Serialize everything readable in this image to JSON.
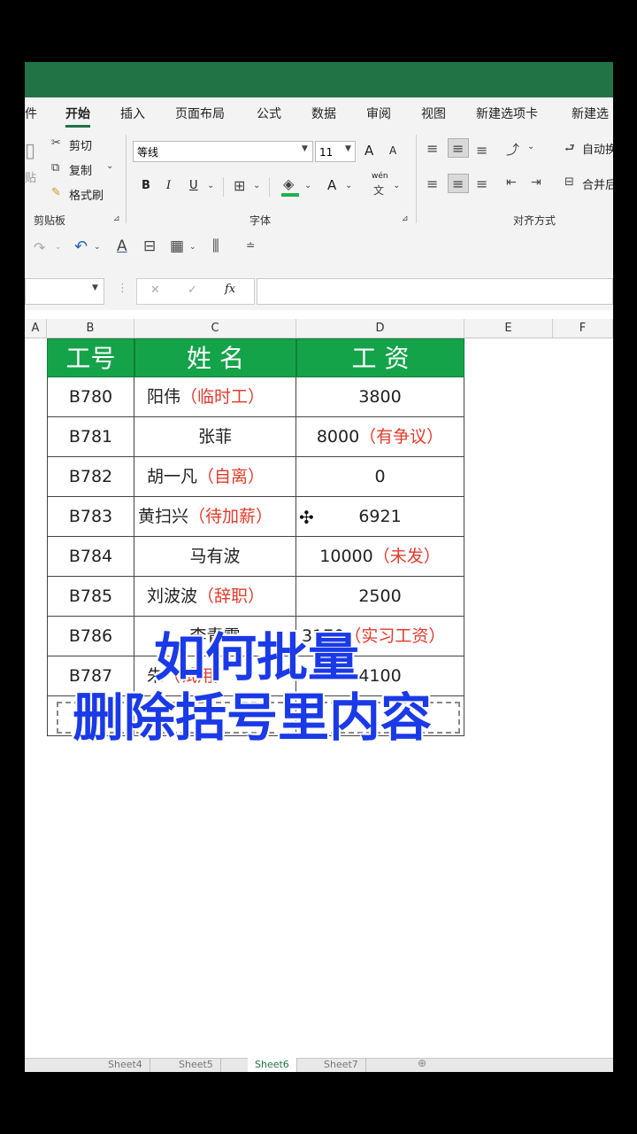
{
  "ribbon_tabs": [
    "件",
    "开始",
    "插入",
    "页面布局",
    "公式",
    "数据",
    "审阅",
    "视图",
    "新建选项卡",
    "新建选"
  ],
  "clipboard": {
    "cut": "剪切",
    "copy": "复制",
    "format_painter": "格式刷",
    "paste": "贴",
    "group": "剪贴板"
  },
  "font": {
    "name": "等线",
    "size": "11",
    "bold": "B",
    "italic": "I",
    "underline": "U",
    "font_color": "A",
    "wen": "wén",
    "group": "字体",
    "grow": "A",
    "shrink": "A"
  },
  "alignment": {
    "wrap": "自动换",
    "merge": "合并后",
    "group": "对齐方式"
  },
  "formula_bar": {
    "fx": "fx",
    "cancel": "✕",
    "enter": "✓"
  },
  "columns": [
    "A",
    "B",
    "C",
    "D",
    "E",
    "F"
  ],
  "table": {
    "headers": [
      "工号",
      "姓 名",
      "工 资"
    ],
    "rows": [
      {
        "id": "B780",
        "name": "阳伟",
        "name_note": "（临时工）",
        "salary": "3800",
        "salary_note": ""
      },
      {
        "id": "B781",
        "name": "张菲",
        "name_note": "",
        "salary": "8000",
        "salary_note": "（有争议）"
      },
      {
        "id": "B782",
        "name": "胡一凡",
        "name_note": "（自离）",
        "salary": "0",
        "salary_note": ""
      },
      {
        "id": "B783",
        "name": "黄扫兴",
        "name_note": "（待加薪）",
        "salary": "6921",
        "salary_note": ""
      },
      {
        "id": "B784",
        "name": "马有波",
        "name_note": "",
        "salary": "10000",
        "salary_note": "（未发）"
      },
      {
        "id": "B785",
        "name": "刘波波",
        "name_note": "（辞职）",
        "salary": "2500",
        "salary_note": ""
      },
      {
        "id": "B786",
        "name": "李青霞",
        "name_note": "",
        "salary": "3170",
        "salary_note": "（实习工资）"
      },
      {
        "id": "B787",
        "name": "朱",
        "name_note": "（试用）",
        "salary": "4100",
        "salary_note": ""
      }
    ]
  },
  "overlay": {
    "line1": "如何批量",
    "line2": "删除括号里内容"
  },
  "sheets": [
    "Sheet4",
    "Sheet5",
    "Sheet6",
    "Sheet7"
  ],
  "colors": {
    "excel_green": "#217346",
    "header_green": "#15a34a",
    "note_red": "#e03c2d",
    "overlay_blue": "#1a3ae8"
  }
}
